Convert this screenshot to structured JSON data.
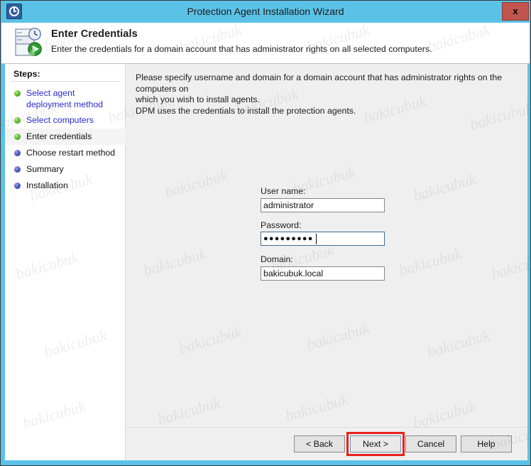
{
  "window": {
    "title": "Protection Agent Installation Wizard",
    "app_icon": "clock-icon",
    "close_label": "x",
    "frame_color": "#5bc2e7",
    "close_color": "#c1544c"
  },
  "header": {
    "icon": "server-clock-deploy-icon",
    "title": "Enter Credentials",
    "subtitle": "Enter the credentials for a domain account that has administrator rights on all selected computers."
  },
  "sidebar": {
    "heading": "Steps:",
    "items": [
      {
        "label": "Select agent deployment method",
        "state": "done",
        "bullet": "green-bullet-icon"
      },
      {
        "label": "Select computers",
        "state": "done",
        "bullet": "green-bullet-icon"
      },
      {
        "label": "Enter credentials",
        "state": "current",
        "bullet": "green-bullet-icon"
      },
      {
        "label": "Choose restart method",
        "state": "pending",
        "bullet": "blue-bullet-icon"
      },
      {
        "label": "Summary",
        "state": "pending",
        "bullet": "blue-bullet-icon"
      },
      {
        "label": "Installation",
        "state": "pending",
        "bullet": "blue-bullet-icon"
      }
    ]
  },
  "content": {
    "intro_line1": "Please specify username and domain for a domain account that has administrator rights on the computers on",
    "intro_line2": "which you wish to install agents.",
    "intro_line3": "DPM uses the credentials to install the protection agents.",
    "fields": {
      "username": {
        "label": "User name:",
        "value": "administrator",
        "placeholder": ""
      },
      "password": {
        "label": "Password:",
        "value": "●●●●●●●●●",
        "placeholder": "",
        "focused": true
      },
      "domain": {
        "label": "Domain:",
        "value": "bakicubuk.local",
        "placeholder": ""
      }
    }
  },
  "buttons": {
    "back": "< Back",
    "next": "Next >",
    "cancel": "Cancel",
    "help": "Help",
    "highlight_color": "#e8211c",
    "highlighted": "next"
  },
  "watermark": {
    "text": "bakicubuk"
  }
}
